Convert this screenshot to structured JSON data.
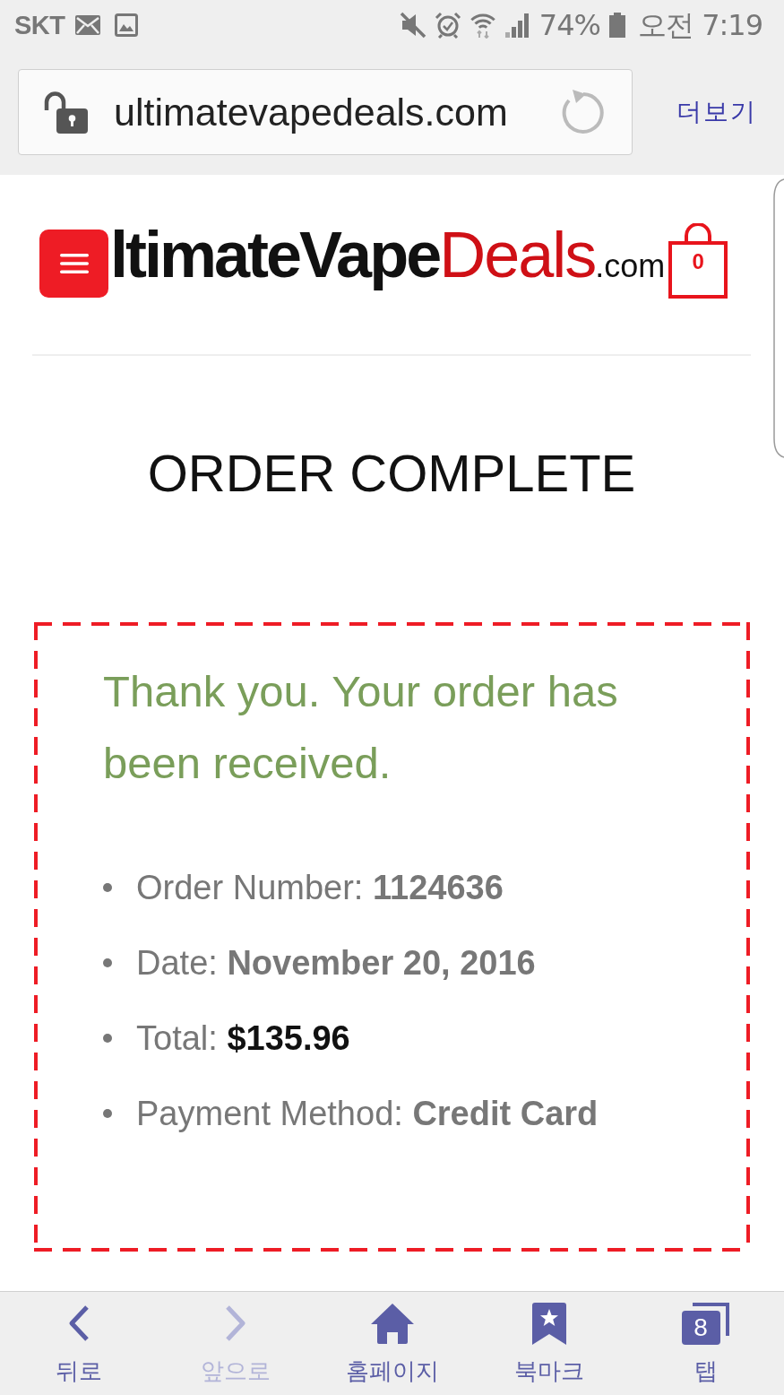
{
  "status_bar": {
    "carrier": "SKT",
    "battery_percent": "74%",
    "time": "오전 7:19"
  },
  "browser_toolbar": {
    "url": "ultimatevapedeals.com",
    "more_label": "더보기"
  },
  "site_header": {
    "logo_parts": [
      {
        "text": "ltimateVape",
        "kind": "dark"
      },
      {
        "text": "Deals",
        "kind": "red"
      },
      {
        "text": ".com",
        "kind": "small"
      }
    ],
    "cart_count": "0"
  },
  "page_title": "ORDER COMPLETE",
  "order_notice": {
    "message": "Thank you. Your order has been received.",
    "details": [
      {
        "text": "Order Number: **1124636**",
        "emphasis": false
      },
      {
        "text": "Date: **November 20, 2016**",
        "emphasis": false
      },
      {
        "text": "Total: **$135.96**",
        "emphasis": true
      },
      {
        "text": "Payment Method: **Credit Card**",
        "emphasis": false
      }
    ]
  },
  "bottom_nav": [
    {
      "label": "뒤로",
      "kind": "back",
      "disabled": false
    },
    {
      "label": "앞으로",
      "kind": "forward",
      "disabled": true
    },
    {
      "label": "홈페이지",
      "kind": "home",
      "disabled": false
    },
    {
      "label": "북마크",
      "kind": "bookmark",
      "disabled": false
    },
    {
      "label": "탭",
      "kind": "tabs",
      "disabled": false,
      "badge": "8"
    }
  ]
}
